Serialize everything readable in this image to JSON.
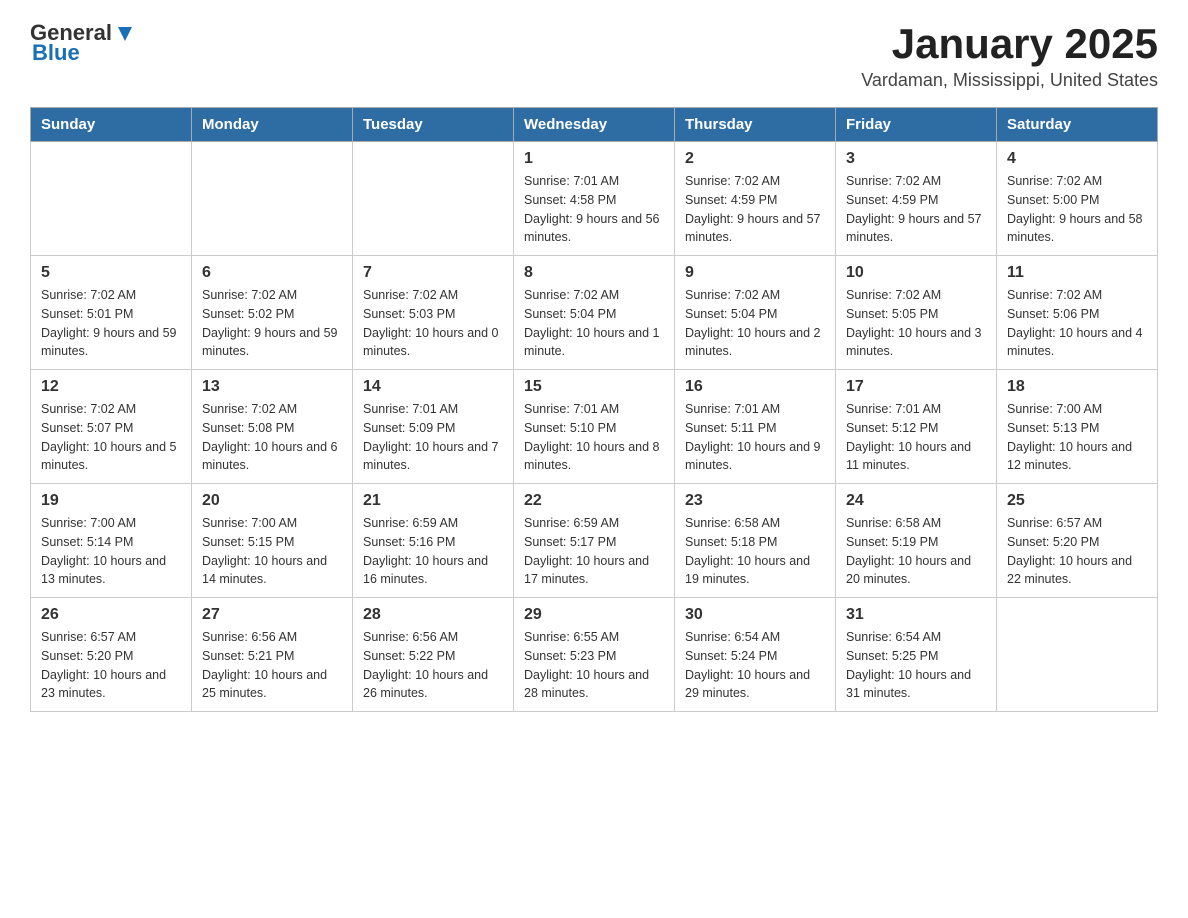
{
  "header": {
    "logo_general": "General",
    "logo_blue": "Blue",
    "month_year": "January 2025",
    "location": "Vardaman, Mississippi, United States"
  },
  "days_of_week": [
    "Sunday",
    "Monday",
    "Tuesday",
    "Wednesday",
    "Thursday",
    "Friday",
    "Saturday"
  ],
  "weeks": [
    [
      {
        "day": "",
        "info": ""
      },
      {
        "day": "",
        "info": ""
      },
      {
        "day": "",
        "info": ""
      },
      {
        "day": "1",
        "info": "Sunrise: 7:01 AM\nSunset: 4:58 PM\nDaylight: 9 hours and 56 minutes."
      },
      {
        "day": "2",
        "info": "Sunrise: 7:02 AM\nSunset: 4:59 PM\nDaylight: 9 hours and 57 minutes."
      },
      {
        "day": "3",
        "info": "Sunrise: 7:02 AM\nSunset: 4:59 PM\nDaylight: 9 hours and 57 minutes."
      },
      {
        "day": "4",
        "info": "Sunrise: 7:02 AM\nSunset: 5:00 PM\nDaylight: 9 hours and 58 minutes."
      }
    ],
    [
      {
        "day": "5",
        "info": "Sunrise: 7:02 AM\nSunset: 5:01 PM\nDaylight: 9 hours and 59 minutes."
      },
      {
        "day": "6",
        "info": "Sunrise: 7:02 AM\nSunset: 5:02 PM\nDaylight: 9 hours and 59 minutes."
      },
      {
        "day": "7",
        "info": "Sunrise: 7:02 AM\nSunset: 5:03 PM\nDaylight: 10 hours and 0 minutes."
      },
      {
        "day": "8",
        "info": "Sunrise: 7:02 AM\nSunset: 5:04 PM\nDaylight: 10 hours and 1 minute."
      },
      {
        "day": "9",
        "info": "Sunrise: 7:02 AM\nSunset: 5:04 PM\nDaylight: 10 hours and 2 minutes."
      },
      {
        "day": "10",
        "info": "Sunrise: 7:02 AM\nSunset: 5:05 PM\nDaylight: 10 hours and 3 minutes."
      },
      {
        "day": "11",
        "info": "Sunrise: 7:02 AM\nSunset: 5:06 PM\nDaylight: 10 hours and 4 minutes."
      }
    ],
    [
      {
        "day": "12",
        "info": "Sunrise: 7:02 AM\nSunset: 5:07 PM\nDaylight: 10 hours and 5 minutes."
      },
      {
        "day": "13",
        "info": "Sunrise: 7:02 AM\nSunset: 5:08 PM\nDaylight: 10 hours and 6 minutes."
      },
      {
        "day": "14",
        "info": "Sunrise: 7:01 AM\nSunset: 5:09 PM\nDaylight: 10 hours and 7 minutes."
      },
      {
        "day": "15",
        "info": "Sunrise: 7:01 AM\nSunset: 5:10 PM\nDaylight: 10 hours and 8 minutes."
      },
      {
        "day": "16",
        "info": "Sunrise: 7:01 AM\nSunset: 5:11 PM\nDaylight: 10 hours and 9 minutes."
      },
      {
        "day": "17",
        "info": "Sunrise: 7:01 AM\nSunset: 5:12 PM\nDaylight: 10 hours and 11 minutes."
      },
      {
        "day": "18",
        "info": "Sunrise: 7:00 AM\nSunset: 5:13 PM\nDaylight: 10 hours and 12 minutes."
      }
    ],
    [
      {
        "day": "19",
        "info": "Sunrise: 7:00 AM\nSunset: 5:14 PM\nDaylight: 10 hours and 13 minutes."
      },
      {
        "day": "20",
        "info": "Sunrise: 7:00 AM\nSunset: 5:15 PM\nDaylight: 10 hours and 14 minutes."
      },
      {
        "day": "21",
        "info": "Sunrise: 6:59 AM\nSunset: 5:16 PM\nDaylight: 10 hours and 16 minutes."
      },
      {
        "day": "22",
        "info": "Sunrise: 6:59 AM\nSunset: 5:17 PM\nDaylight: 10 hours and 17 minutes."
      },
      {
        "day": "23",
        "info": "Sunrise: 6:58 AM\nSunset: 5:18 PM\nDaylight: 10 hours and 19 minutes."
      },
      {
        "day": "24",
        "info": "Sunrise: 6:58 AM\nSunset: 5:19 PM\nDaylight: 10 hours and 20 minutes."
      },
      {
        "day": "25",
        "info": "Sunrise: 6:57 AM\nSunset: 5:20 PM\nDaylight: 10 hours and 22 minutes."
      }
    ],
    [
      {
        "day": "26",
        "info": "Sunrise: 6:57 AM\nSunset: 5:20 PM\nDaylight: 10 hours and 23 minutes."
      },
      {
        "day": "27",
        "info": "Sunrise: 6:56 AM\nSunset: 5:21 PM\nDaylight: 10 hours and 25 minutes."
      },
      {
        "day": "28",
        "info": "Sunrise: 6:56 AM\nSunset: 5:22 PM\nDaylight: 10 hours and 26 minutes."
      },
      {
        "day": "29",
        "info": "Sunrise: 6:55 AM\nSunset: 5:23 PM\nDaylight: 10 hours and 28 minutes."
      },
      {
        "day": "30",
        "info": "Sunrise: 6:54 AM\nSunset: 5:24 PM\nDaylight: 10 hours and 29 minutes."
      },
      {
        "day": "31",
        "info": "Sunrise: 6:54 AM\nSunset: 5:25 PM\nDaylight: 10 hours and 31 minutes."
      },
      {
        "day": "",
        "info": ""
      }
    ]
  ]
}
